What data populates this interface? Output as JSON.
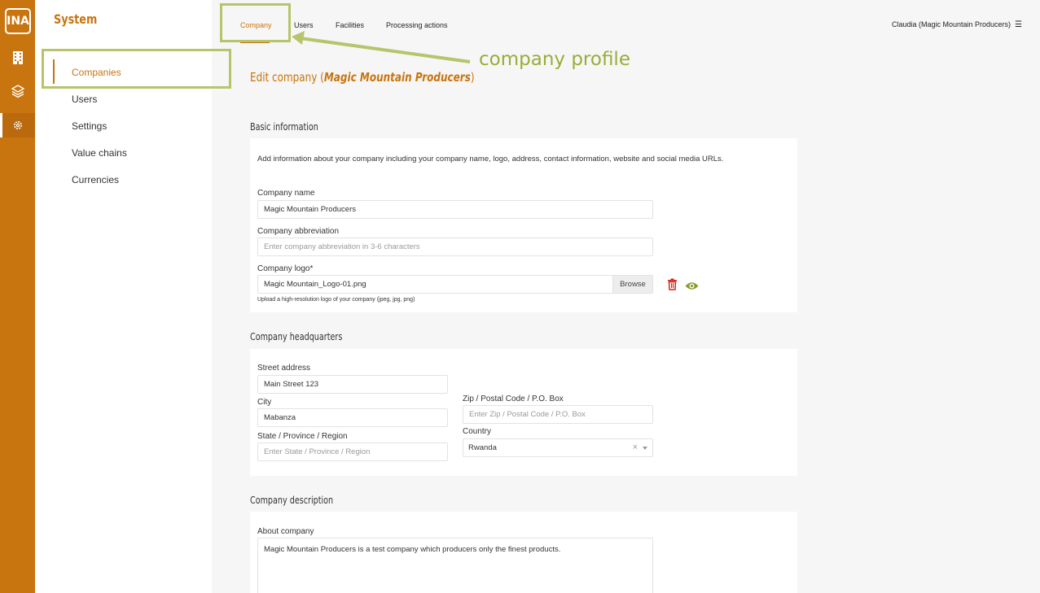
{
  "rail": {
    "logo": "INA",
    "icons": [
      "building-icon",
      "layers-icon",
      "gear-icon"
    ]
  },
  "sidebar": {
    "title": "System",
    "items": [
      {
        "label": "Companies",
        "active": true
      },
      {
        "label": "Users"
      },
      {
        "label": "Settings"
      },
      {
        "label": "Value chains"
      },
      {
        "label": "Currencies"
      }
    ]
  },
  "topbar": {
    "tabs": [
      {
        "label": "Company",
        "active": true
      },
      {
        "label": "Users"
      },
      {
        "label": "Facilities"
      },
      {
        "label": "Processing actions"
      }
    ],
    "user": "Claudia (Magic Mountain Producers)"
  },
  "page": {
    "title_prefix": "Edit company (",
    "title_company": "Magic Mountain Producers",
    "title_suffix": ")"
  },
  "basic_info": {
    "title": "Basic information",
    "intro": "Add information about your company including your company name, logo, address, contact information, website and social media URLs.",
    "company_name_label": "Company name",
    "company_name_value": "Magic Mountain Producers",
    "abbreviation_label": "Company abbreviation",
    "abbreviation_placeholder": "Enter company abbreviation in 3-6 characters",
    "logo_label": "Company logo*",
    "logo_value": "Magic Mountain_Logo-01.png",
    "browse_label": "Browse",
    "logo_hint": "Upload a high-resolution logo of your company (jpeg, jpg, png)"
  },
  "headquarters": {
    "title": "Company headquarters",
    "street_label": "Street address",
    "street_value": "Main Street 123",
    "city_label": "City",
    "city_value": "Mabanza",
    "state_label": "State / Province / Region",
    "state_placeholder": "Enter State / Province / Region",
    "zip_label": "Zip / Postal Code / P.O. Box",
    "zip_placeholder": "Enter Zip / Postal Code / P.O. Box",
    "country_label": "Country",
    "country_value": "Rwanda"
  },
  "description": {
    "title": "Company description",
    "about_label": "About company",
    "about_value": "Magic Mountain Producers is a test company which producers only the finest products."
  },
  "annotation": {
    "text": "company profile",
    "color": "#9aac38"
  },
  "colors": {
    "brand": "#c8740f",
    "annotation_border": "#b7c46b",
    "delete": "#d0241b",
    "view": "#8a9a2a"
  }
}
